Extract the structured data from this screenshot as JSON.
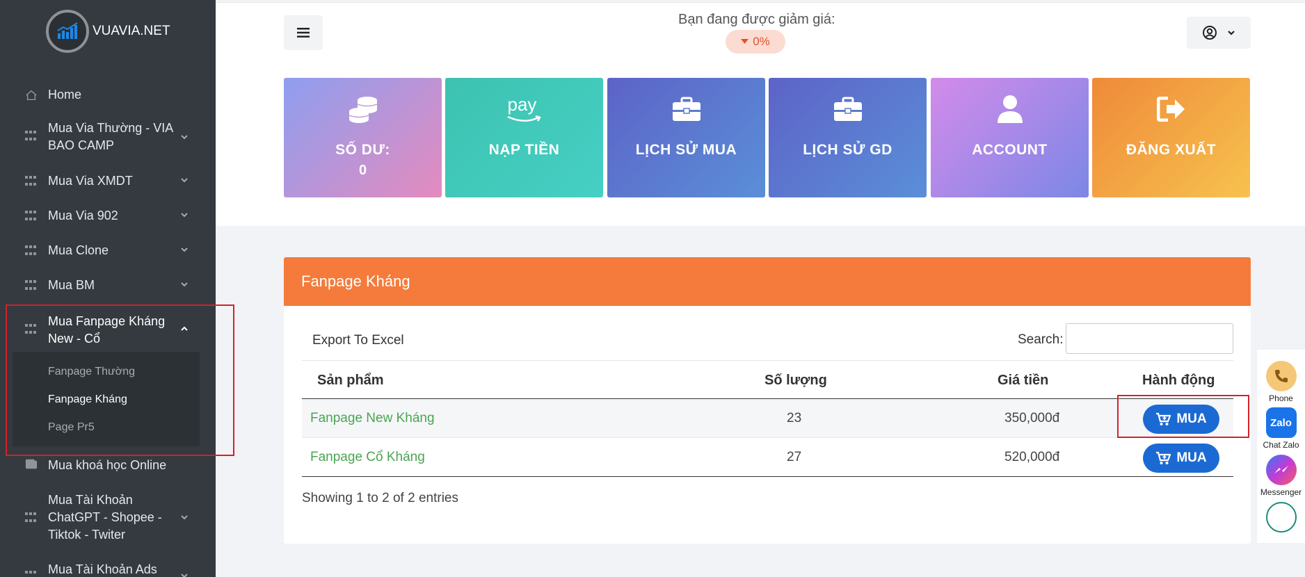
{
  "brand": {
    "name": "VUAVIA.NET"
  },
  "sidebar": {
    "items": [
      {
        "label": "Home",
        "icon": "home-icon"
      },
      {
        "label": "Mua Via Thường - VIA BAO CAMP",
        "icon": "grid-icon"
      },
      {
        "label": "Mua Via XMDT",
        "icon": "grid-icon"
      },
      {
        "label": "Mua Via 902",
        "icon": "grid-icon"
      },
      {
        "label": "Mua Clone",
        "icon": "grid-icon"
      },
      {
        "label": "Mua BM",
        "icon": "grid-icon"
      },
      {
        "label": "Mua Fanpage Kháng New - Cổ",
        "icon": "grid-icon"
      },
      {
        "label": "Mua khoá học Online",
        "icon": "wallet-icon"
      },
      {
        "label": "Mua Tài Khoản ChatGPT - Shopee - Tiktok - Twiter",
        "icon": "grid-icon"
      },
      {
        "label": "Mua Tài Khoản Ads",
        "icon": "grid-icon"
      }
    ],
    "submenu": [
      {
        "label": "Fanpage Thường"
      },
      {
        "label": "Fanpage Kháng"
      },
      {
        "label": "Page Pr5"
      }
    ]
  },
  "header": {
    "discount_label": "Bạn đang được giảm giá:",
    "discount_value": "0%"
  },
  "cards": [
    {
      "title": "SỐ DƯ:",
      "value": "0",
      "icon": "coins-icon"
    },
    {
      "title": "NẠP TIỀN",
      "icon": "pay-icon",
      "icon_text": "pay"
    },
    {
      "title": "LỊCH SỬ MUA",
      "icon": "briefcase-icon"
    },
    {
      "title": "LỊCH SỬ GD",
      "icon": "briefcase-icon"
    },
    {
      "title": "ACCOUNT",
      "icon": "user-icon"
    },
    {
      "title": "ĐĂNG XUẤT",
      "icon": "sign-out-icon"
    }
  ],
  "panel": {
    "title": "Fanpage Kháng",
    "export_label": "Export To Excel",
    "search_label": "Search:",
    "columns": [
      "Sản phẩm",
      "Số lượng",
      "Giá tiền",
      "Hành động"
    ],
    "rows": [
      {
        "name": "Fanpage New Kháng",
        "qty": "23",
        "price": "350,000đ",
        "action": "MUA"
      },
      {
        "name": "Fanpage Cổ Kháng",
        "qty": "27",
        "price": "520,000đ",
        "action": "MUA"
      }
    ],
    "footer": "Showing 1 to 2 of 2 entries"
  },
  "contact": {
    "phone": "Phone",
    "zalo": "Chat Zalo",
    "zalo_icon_text": "Zalo",
    "messenger": "Messenger"
  },
  "colors": {
    "sidebar": "#343a40",
    "panel_header": "#f47b3b",
    "buy_button": "#1b6ad4",
    "product_link": "#4aa551",
    "highlight": "#d62029"
  }
}
